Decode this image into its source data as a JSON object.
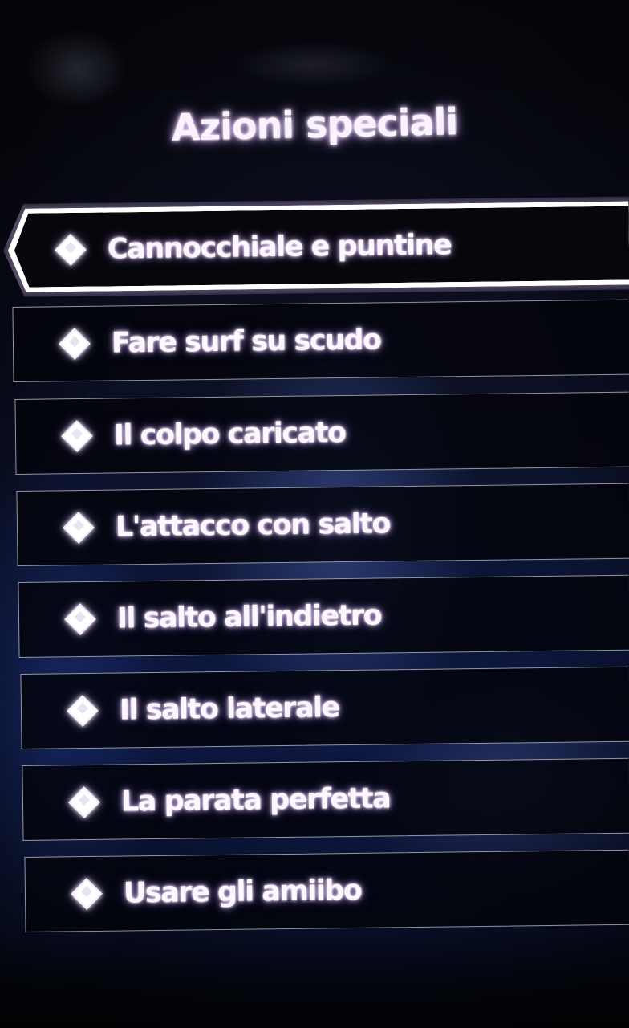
{
  "screen": {
    "title": "Azioni speciali"
  },
  "menu": {
    "selected_index": 0,
    "items": [
      {
        "label": "Cannocchiale e puntine"
      },
      {
        "label": "Fare surf su scudo"
      },
      {
        "label": "Il colpo caricato"
      },
      {
        "label": "L'attacco con salto"
      },
      {
        "label": "Il salto all'indietro"
      },
      {
        "label": "Il salto laterale"
      },
      {
        "label": "La parata perfetta"
      },
      {
        "label": "Usare gli amiibo"
      }
    ]
  },
  "colors": {
    "text": "#fdf6ff",
    "glow": "#d9b8ff",
    "item_background": "#03040a",
    "item_border": "#c8c8d7"
  },
  "icons": {
    "bullet": "diamond-bullet-icon"
  }
}
